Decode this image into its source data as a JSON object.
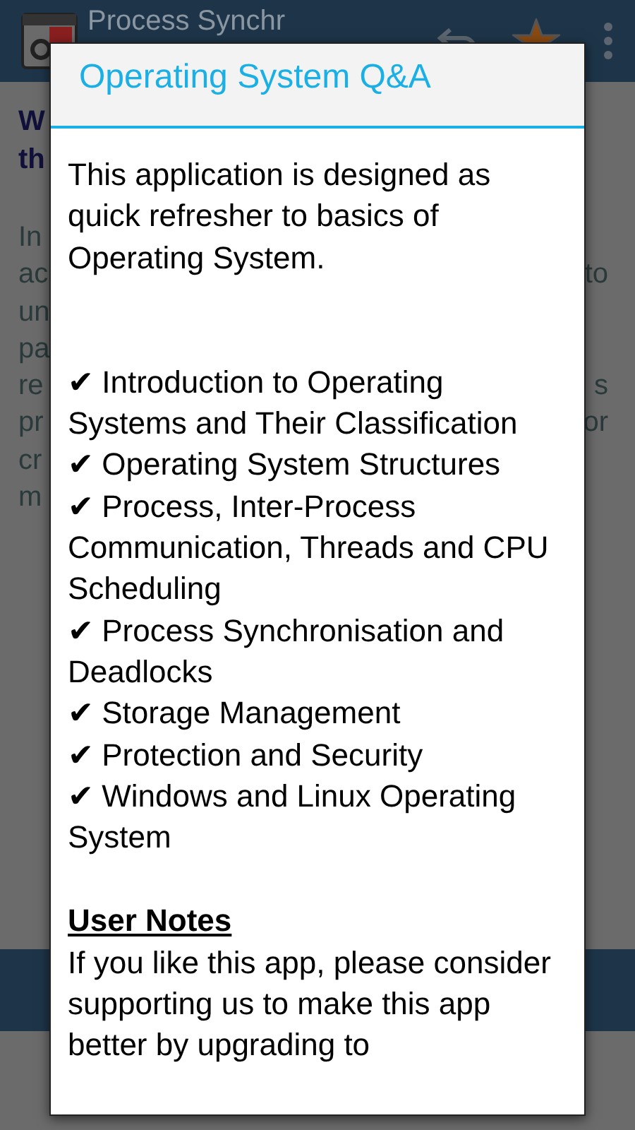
{
  "app_bar": {
    "title": "Process Synchr"
  },
  "background": {
    "heading_lines": [
      "W",
      "th"
    ],
    "rows": [
      {
        "left": "In"
      },
      {
        "left": "ac",
        "right": "to"
      },
      {
        "left": "un"
      },
      {
        "left": "pa"
      },
      {
        "left": "re",
        "right": "s"
      },
      {
        "left": "pr",
        "right": "or"
      },
      {
        "left": "cr"
      },
      {
        "left": "m"
      }
    ]
  },
  "dialog": {
    "title": "Operating System Q&A",
    "intro": "This application is designed as quick refresher to basics of Operating System.",
    "topics": [
      "✔ Introduction to Operating Systems and Their Classification",
      "✔ Operating System Structures",
      "✔ Process, Inter-Process Communication, Threads and CPU Scheduling",
      "✔ Process Synchronisation and Deadlocks",
      "✔ Storage Management",
      "✔ Protection and Security",
      "✔ Windows and Linux Operating System"
    ],
    "notes_heading": "User Notes",
    "notes_text": "If you like this app, please consider supporting us to make this app better by upgrading to"
  }
}
